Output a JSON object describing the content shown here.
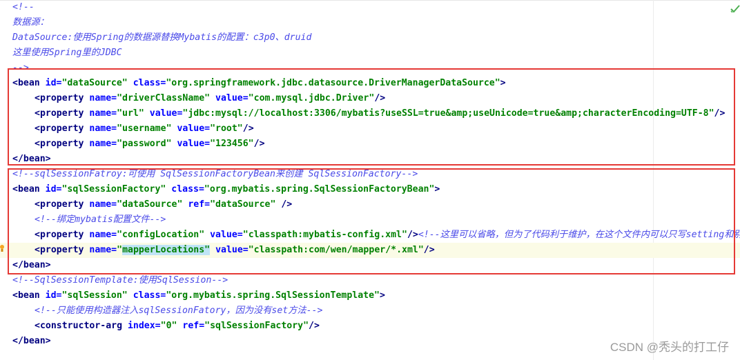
{
  "editor": {
    "lines": [
      [
        {
          "t": "cmt",
          "v": "<!--"
        }
      ],
      [
        {
          "t": "cmt",
          "v": "数据源："
        }
      ],
      [
        {
          "t": "cmt",
          "v": "DataSource:使用Spring的数据源替换Mybatis的配置：c3p0、druid"
        }
      ],
      [
        {
          "t": "cmt",
          "v": "这里使用Spring里的JDBC"
        }
      ],
      [
        {
          "t": "cmt",
          "v": "-->"
        }
      ],
      [
        {
          "t": "tag",
          "v": "<bean "
        },
        {
          "t": "attr",
          "v": "id="
        },
        {
          "t": "val",
          "v": "\"dataSource\""
        },
        {
          "t": "txt",
          "v": " "
        },
        {
          "t": "attr",
          "v": "class="
        },
        {
          "t": "val",
          "v": "\"org.springframework.jdbc.datasource.DriverManagerDataSource\""
        },
        {
          "t": "tag",
          "v": ">"
        }
      ],
      [
        {
          "t": "ind"
        },
        {
          "t": "tag",
          "v": "<property "
        },
        {
          "t": "attr",
          "v": "name="
        },
        {
          "t": "val",
          "v": "\"driverClassName\""
        },
        {
          "t": "txt",
          "v": " "
        },
        {
          "t": "attr",
          "v": "value="
        },
        {
          "t": "val",
          "v": "\"com.mysql.jdbc.Driver\""
        },
        {
          "t": "tag",
          "v": "/>"
        }
      ],
      [
        {
          "t": "ind"
        },
        {
          "t": "tag",
          "v": "<property "
        },
        {
          "t": "attr",
          "v": "name="
        },
        {
          "t": "val",
          "v": "\"url\""
        },
        {
          "t": "txt",
          "v": " "
        },
        {
          "t": "attr",
          "v": "value="
        },
        {
          "t": "val",
          "v": "\"jdbc:mysql://localhost:3306/mybatis?useSSL=true&amp;useUnicode=true&amp;characterEncoding=UTF-8\""
        },
        {
          "t": "tag",
          "v": "/>"
        }
      ],
      [
        {
          "t": "ind"
        },
        {
          "t": "tag",
          "v": "<property "
        },
        {
          "t": "attr",
          "v": "name="
        },
        {
          "t": "val",
          "v": "\"username\""
        },
        {
          "t": "txt",
          "v": " "
        },
        {
          "t": "attr",
          "v": "value="
        },
        {
          "t": "val",
          "v": "\"root\""
        },
        {
          "t": "tag",
          "v": "/>"
        }
      ],
      [
        {
          "t": "ind"
        },
        {
          "t": "tag",
          "v": "<property "
        },
        {
          "t": "attr",
          "v": "name="
        },
        {
          "t": "val",
          "v": "\"password\""
        },
        {
          "t": "txt",
          "v": " "
        },
        {
          "t": "attr",
          "v": "value="
        },
        {
          "t": "val",
          "v": "\"123456\""
        },
        {
          "t": "tag",
          "v": "/>"
        }
      ],
      [
        {
          "t": "tag",
          "v": "</bean>"
        }
      ],
      [
        {
          "t": "cmt",
          "v": "<!--sqlSessionFatroy:可使用 SqlSessionFactoryBean来创建 SqlSessionFactory-->"
        }
      ],
      [
        {
          "t": "tag",
          "v": "<bean "
        },
        {
          "t": "attr",
          "v": "id="
        },
        {
          "t": "val",
          "v": "\"sqlSessionFactory\""
        },
        {
          "t": "txt",
          "v": " "
        },
        {
          "t": "attr",
          "v": "class="
        },
        {
          "t": "val",
          "v": "\"org.mybatis.spring.SqlSessionFactoryBean\""
        },
        {
          "t": "tag",
          "v": ">"
        }
      ],
      [
        {
          "t": "ind"
        },
        {
          "t": "tag",
          "v": "<property "
        },
        {
          "t": "attr",
          "v": "name="
        },
        {
          "t": "val",
          "v": "\"dataSource\""
        },
        {
          "t": "txt",
          "v": " "
        },
        {
          "t": "attr",
          "v": "ref="
        },
        {
          "t": "val",
          "v": "\"dataSource\""
        },
        {
          "t": "txt",
          "v": " "
        },
        {
          "t": "tag",
          "v": "/>"
        }
      ],
      [
        {
          "t": "ind"
        },
        {
          "t": "cmt",
          "v": "<!--绑定mybatis配置文件-->"
        }
      ],
      [
        {
          "t": "ind"
        },
        {
          "t": "tag",
          "v": "<property "
        },
        {
          "t": "attr",
          "v": "name="
        },
        {
          "t": "val",
          "v": "\"configLocation\""
        },
        {
          "t": "txt",
          "v": " "
        },
        {
          "t": "attr",
          "v": "value="
        },
        {
          "t": "val",
          "v": "\"classpath:mybatis-config.xml\""
        },
        {
          "t": "tag",
          "v": "/>"
        },
        {
          "t": "cmt",
          "v": "<!--这里可以省略，但为了代码利于维护，在这个文件内可以只写setting和别"
        }
      ],
      [
        {
          "t": "ind"
        },
        {
          "t": "tag",
          "v": "<property "
        },
        {
          "t": "attr",
          "v": "name="
        },
        {
          "t": "val",
          "v": "\""
        },
        {
          "t": "valhl",
          "v": "mapperLocations\""
        },
        {
          "t": "txt",
          "v": " "
        },
        {
          "t": "attr",
          "v": "value="
        },
        {
          "t": "val",
          "v": "\"classpath:com/wen/mapper/*.xml\""
        },
        {
          "t": "tag",
          "v": "/>"
        }
      ],
      [
        {
          "t": "tag",
          "v": "</bean>"
        }
      ],
      [
        {
          "t": "cmt",
          "v": "<!--SqlSessionTemplate:使用SqlSession-->"
        }
      ],
      [
        {
          "t": "tag",
          "v": "<bean "
        },
        {
          "t": "attr",
          "v": "id="
        },
        {
          "t": "val",
          "v": "\"sqlSession\""
        },
        {
          "t": "txt",
          "v": " "
        },
        {
          "t": "attr",
          "v": "class="
        },
        {
          "t": "val",
          "v": "\"org.mybatis.spring.SqlSessionTemplate\""
        },
        {
          "t": "tag",
          "v": ">"
        }
      ],
      [
        {
          "t": "ind"
        },
        {
          "t": "cmt",
          "v": "<!--只能使用构造器注入sqlSessionFatory，因为没有set方法-->"
        }
      ],
      [
        {
          "t": "ind"
        },
        {
          "t": "tag",
          "v": "<constructor-arg "
        },
        {
          "t": "attr",
          "v": "index="
        },
        {
          "t": "val",
          "v": "\"0\""
        },
        {
          "t": "txt",
          "v": " "
        },
        {
          "t": "attr",
          "v": "ref="
        },
        {
          "t": "val",
          "v": "\"sqlSessionFactory\""
        },
        {
          "t": "tag",
          "v": "/>"
        }
      ],
      [
        {
          "t": "tag",
          "v": "</bean>"
        }
      ]
    ],
    "highlighted_line": 16
  },
  "watermark": "CSDN @秃头的打工仔",
  "colors": {
    "tag": "#000080",
    "attribute": "#0000ff",
    "value": "#008000",
    "comment": "#4a4ae8",
    "annotation_box": "#e53935",
    "current_line": "#fbfbe6",
    "check": "#4caf50",
    "bulb": "#f5a623"
  },
  "icons": [
    "inspection-ok-check-icon",
    "intention-bulb-icon"
  ]
}
